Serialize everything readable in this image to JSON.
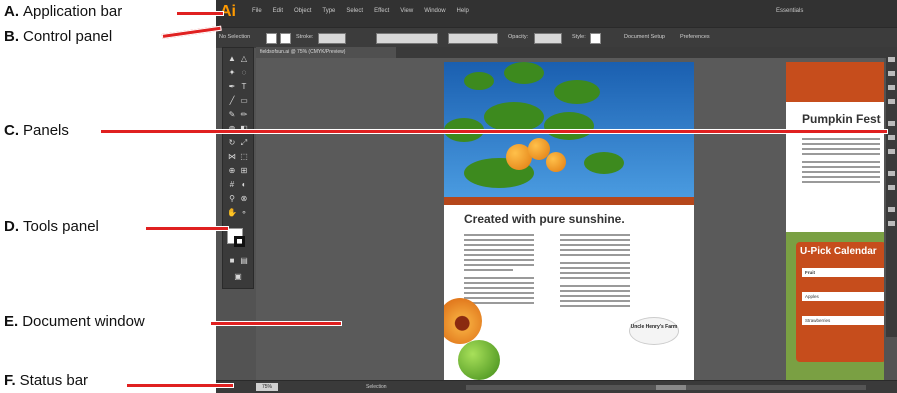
{
  "callouts": [
    {
      "letter": "A.",
      "label": "Application bar"
    },
    {
      "letter": "B.",
      "label": "Control panel"
    },
    {
      "letter": "C.",
      "label": "Panels"
    },
    {
      "letter": "D.",
      "label": "Tools panel"
    },
    {
      "letter": "E.",
      "label": "Document window"
    },
    {
      "letter": "F.",
      "label": "Status bar"
    }
  ],
  "app": {
    "logo": "Ai",
    "menu": [
      "File",
      "Edit",
      "Object",
      "Type",
      "Select",
      "Effect",
      "View",
      "Window",
      "Help"
    ],
    "workspace": "Essentials",
    "control": {
      "selection": "No Selection",
      "stroke": "Stroke:",
      "opacity": "Opacity:",
      "style": "Style:",
      "doc_setup": "Document Setup",
      "prefs": "Preferences"
    },
    "doc_tab": "fieldsofsun.ai @ 75% (CMYK/Preview)",
    "status": {
      "zoom": "75%",
      "tool": "Selection"
    }
  },
  "document": {
    "headline": "Created with pure sunshine.",
    "logo_text": "Uncle Henry's Farm",
    "page2_title": "Pumpkin Fest",
    "calendar_title": "U-Pick Calendar",
    "calendar_rows": [
      "Fruit",
      "Apples",
      "Strawberries"
    ]
  },
  "colors": {
    "accent": "#c64d1c",
    "callout_line": "#e02020",
    "ai_orange": "#ff9a00"
  }
}
